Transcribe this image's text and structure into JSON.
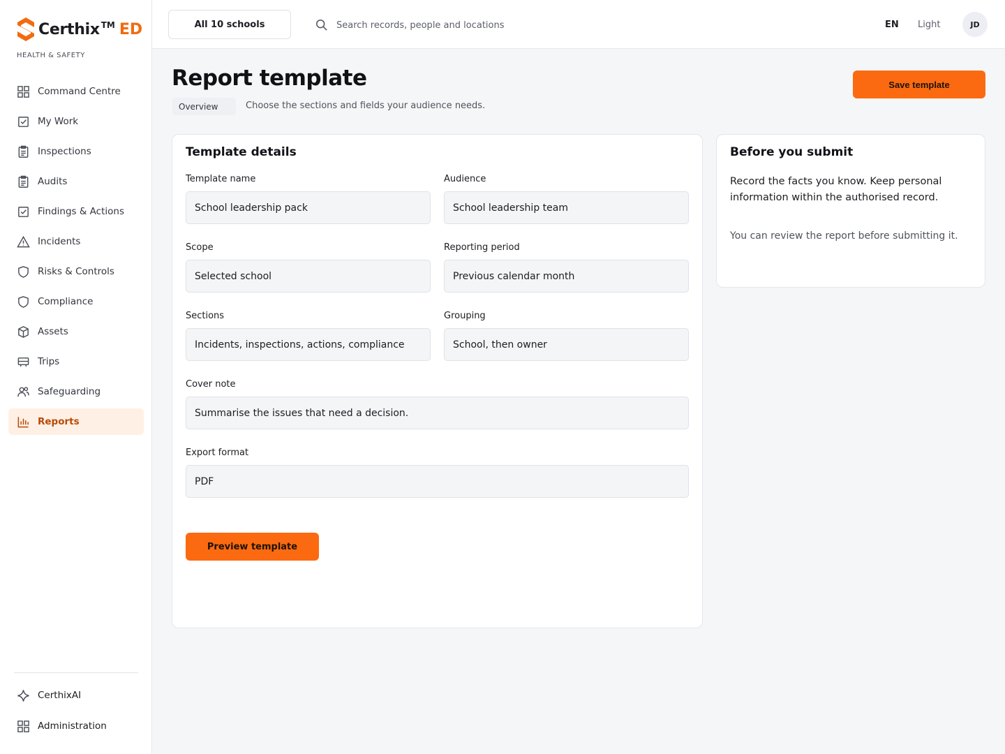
{
  "brand": {
    "name": "Certhix",
    "tm": "TM",
    "suffix": "ED",
    "subtitle": "HEALTH & SAFETY"
  },
  "sidebar": {
    "items": [
      {
        "label": "Command Centre",
        "icon": "grid-icon"
      },
      {
        "label": "My Work",
        "icon": "checkbox-icon"
      },
      {
        "label": "Inspections",
        "icon": "clipboard-icon"
      },
      {
        "label": "Audits",
        "icon": "clipboard-icon"
      },
      {
        "label": "Findings & Actions",
        "icon": "checkbox-icon"
      },
      {
        "label": "Incidents",
        "icon": "warning-triangle-icon"
      },
      {
        "label": "Risks & Controls",
        "icon": "shield-icon"
      },
      {
        "label": "Compliance",
        "icon": "shield-icon"
      },
      {
        "label": "Assets",
        "icon": "cube-icon"
      },
      {
        "label": "Trips",
        "icon": "bus-icon"
      },
      {
        "label": "Safeguarding",
        "icon": "people-icon"
      },
      {
        "label": "Reports",
        "icon": "bar-chart-icon",
        "active": true
      }
    ],
    "bottom": [
      {
        "label": "CerthixAI",
        "icon": "sparkle-icon"
      },
      {
        "label": "Administration",
        "icon": "grid-icon"
      }
    ]
  },
  "topbar": {
    "school_selector": "All 10 schools",
    "search_placeholder": "Search records, people and locations",
    "language": "EN",
    "theme": "Light",
    "avatar_initials": "JD"
  },
  "header": {
    "title": "Report template",
    "tab": "Overview",
    "subtitle": "Choose the sections and fields your audience needs.",
    "save_label": "Save template"
  },
  "details": {
    "title": "Template details",
    "fields": {
      "template_name": {
        "label": "Template name",
        "value": "School leadership pack"
      },
      "audience": {
        "label": "Audience",
        "value": "School leadership team"
      },
      "scope": {
        "label": "Scope",
        "value": "Selected school"
      },
      "reporting_period": {
        "label": "Reporting period",
        "value": "Previous calendar month"
      },
      "sections": {
        "label": "Sections",
        "value": "Incidents, inspections, actions, compliance"
      },
      "grouping": {
        "label": "Grouping",
        "value": "School, then owner"
      },
      "cover_note": {
        "label": "Cover note",
        "value": "Summarise the issues that need a decision."
      },
      "export_format": {
        "label": "Export format",
        "value": "PDF"
      }
    },
    "preview_label": "Preview template"
  },
  "submit_panel": {
    "title": "Before you submit",
    "text": "Record the facts you know. Keep personal information within the authorised record.",
    "note": "You can review the report before submitting it."
  },
  "colors": {
    "accent": "#fb6a10",
    "active_bg": "#fff0e6",
    "active_text": "#b84a05"
  }
}
